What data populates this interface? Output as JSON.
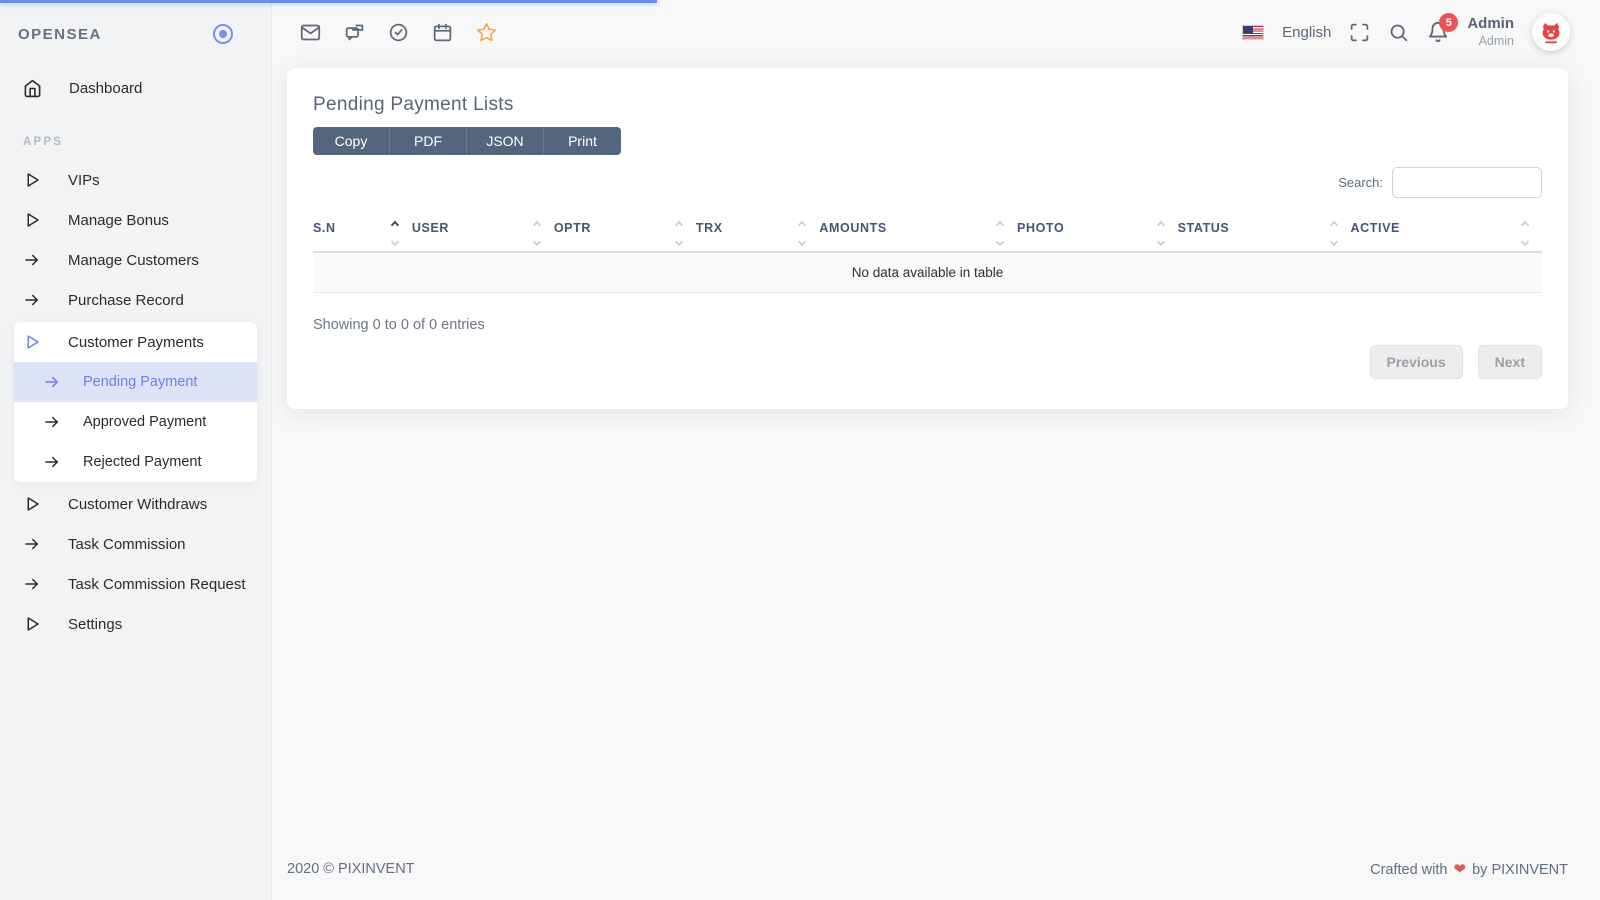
{
  "brand": {
    "name": "OPENSEA"
  },
  "sidebar": {
    "top_item": {
      "label": "Dashboard",
      "icon": "home"
    },
    "section_label": "APPS",
    "items": [
      {
        "label": "VIPs",
        "icon": "triangle"
      },
      {
        "label": "Manage Bonus",
        "icon": "triangle"
      },
      {
        "label": "Manage Customers",
        "icon": "arrow"
      },
      {
        "label": "Purchase Record",
        "icon": "arrow"
      },
      {
        "label": "Customer Payments",
        "icon": "triangle",
        "expanded": true,
        "children": [
          {
            "label": "Pending Payment",
            "active": true
          },
          {
            "label": "Approved Payment",
            "active": false
          },
          {
            "label": "Rejected Payment",
            "active": false
          }
        ]
      },
      {
        "label": "Customer Withdraws",
        "icon": "triangle"
      },
      {
        "label": "Task Commission",
        "icon": "arrow"
      },
      {
        "label": "Task Commission Request",
        "icon": "arrow"
      },
      {
        "label": "Settings",
        "icon": "triangle"
      }
    ]
  },
  "navbar": {
    "bookmark_icons": [
      "mail",
      "chat",
      "check-circle",
      "calendar",
      "star"
    ],
    "language": "English",
    "notification_count": "5",
    "user": {
      "name": "Admin",
      "role": "Admin"
    }
  },
  "card": {
    "title": "Pending Payment Lists",
    "export_buttons": [
      "Copy",
      "PDF",
      "JSON",
      "Print"
    ],
    "search_label": "Search:",
    "search_value": "",
    "table": {
      "columns": [
        "S.N",
        "USER",
        "OPTR",
        "TRX",
        "AMOUNTS",
        "PHOTO",
        "STATUS",
        "ACTIVE"
      ],
      "sorted_column_index": 0,
      "sorted_direction": "asc",
      "empty_message": "No data available in table"
    },
    "info": "Showing 0 to 0 of 0 entries",
    "pagination": {
      "previous": "Previous",
      "next": "Next"
    }
  },
  "footer": {
    "left": "2020 © PIXINVENT",
    "right_prefix": "Crafted with",
    "right_suffix": "by PIXINVENT"
  },
  "colors": {
    "accent_blue": "#7280e8",
    "active_item_bg": "#dce3f6",
    "export_button": "#54657e",
    "badge_red": "#ea5455",
    "star_orange": "#ff9f43",
    "heart_red": "#ea5455",
    "progress_blue": "#6d8de9"
  }
}
